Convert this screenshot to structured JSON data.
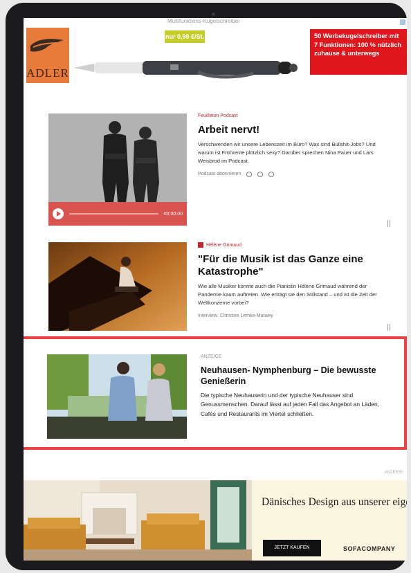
{
  "top_ad": {
    "cut_text": "Multifunktions-Kugelschreiber",
    "brand": "ADLER",
    "price": "nur 0,99 €/St.",
    "red_box_text": "50 Werbekugelschreiber mit 7 Funktionen: 100 % nützlich zuhause & unterwegs"
  },
  "articles": [
    {
      "kicker": "Feuilleton Podcast",
      "headline": "Arbeit nervt!",
      "teaser": "Verschwenden wir unsere Lebenszeit im Büro? Was sind Bullshit-Jobs? Und warum ist Frührente plötzlich sexy? Darüber sprechen Nina Pauer und Lars Weisbrod im Podcast.",
      "meta": "Podcast abonnieren",
      "time": "00:00:00"
    },
    {
      "kicker": "Hélène Grimaud",
      "headline": "\"Für die Musik ist das Ganze eine Katastrophe\"",
      "teaser": "Wie alle Musiker konnte auch die Pianistin Hélène Grimaud während der Pandemie kaum auftreten. Wie erträgt sie den Stillstand – und ist die Zeit der Weltkonzerne vorbei?",
      "meta": "Interview: Christine Lemke-Matwey"
    },
    {
      "kicker": "ANZEIGE",
      "headline": "Neuhausen- Nymphenburg – Die bewusste Genießerin",
      "teaser": "Die typische Neuhauserin und der typische Neuhauser sind Genussmenschen.  Darauf lässt auf jeden Fall das Angebot an Läden, Cafés und Restaurants im Viertel schließen."
    }
  ],
  "bottom_ad": {
    "label": "ANZEIGE",
    "headline": "Dänisches Design aus unserer eigenen Fabrik – direkt zu dir",
    "cta": "JETZT KAUFEN",
    "brand": "SOFACOMPANY"
  },
  "colors": {
    "accent_red": "#e8433f",
    "kicker_red": "#c1272d",
    "podcast_bar": "#d9534f",
    "adler_orange": "#e87a3c",
    "price_green": "#c5cd2c"
  }
}
